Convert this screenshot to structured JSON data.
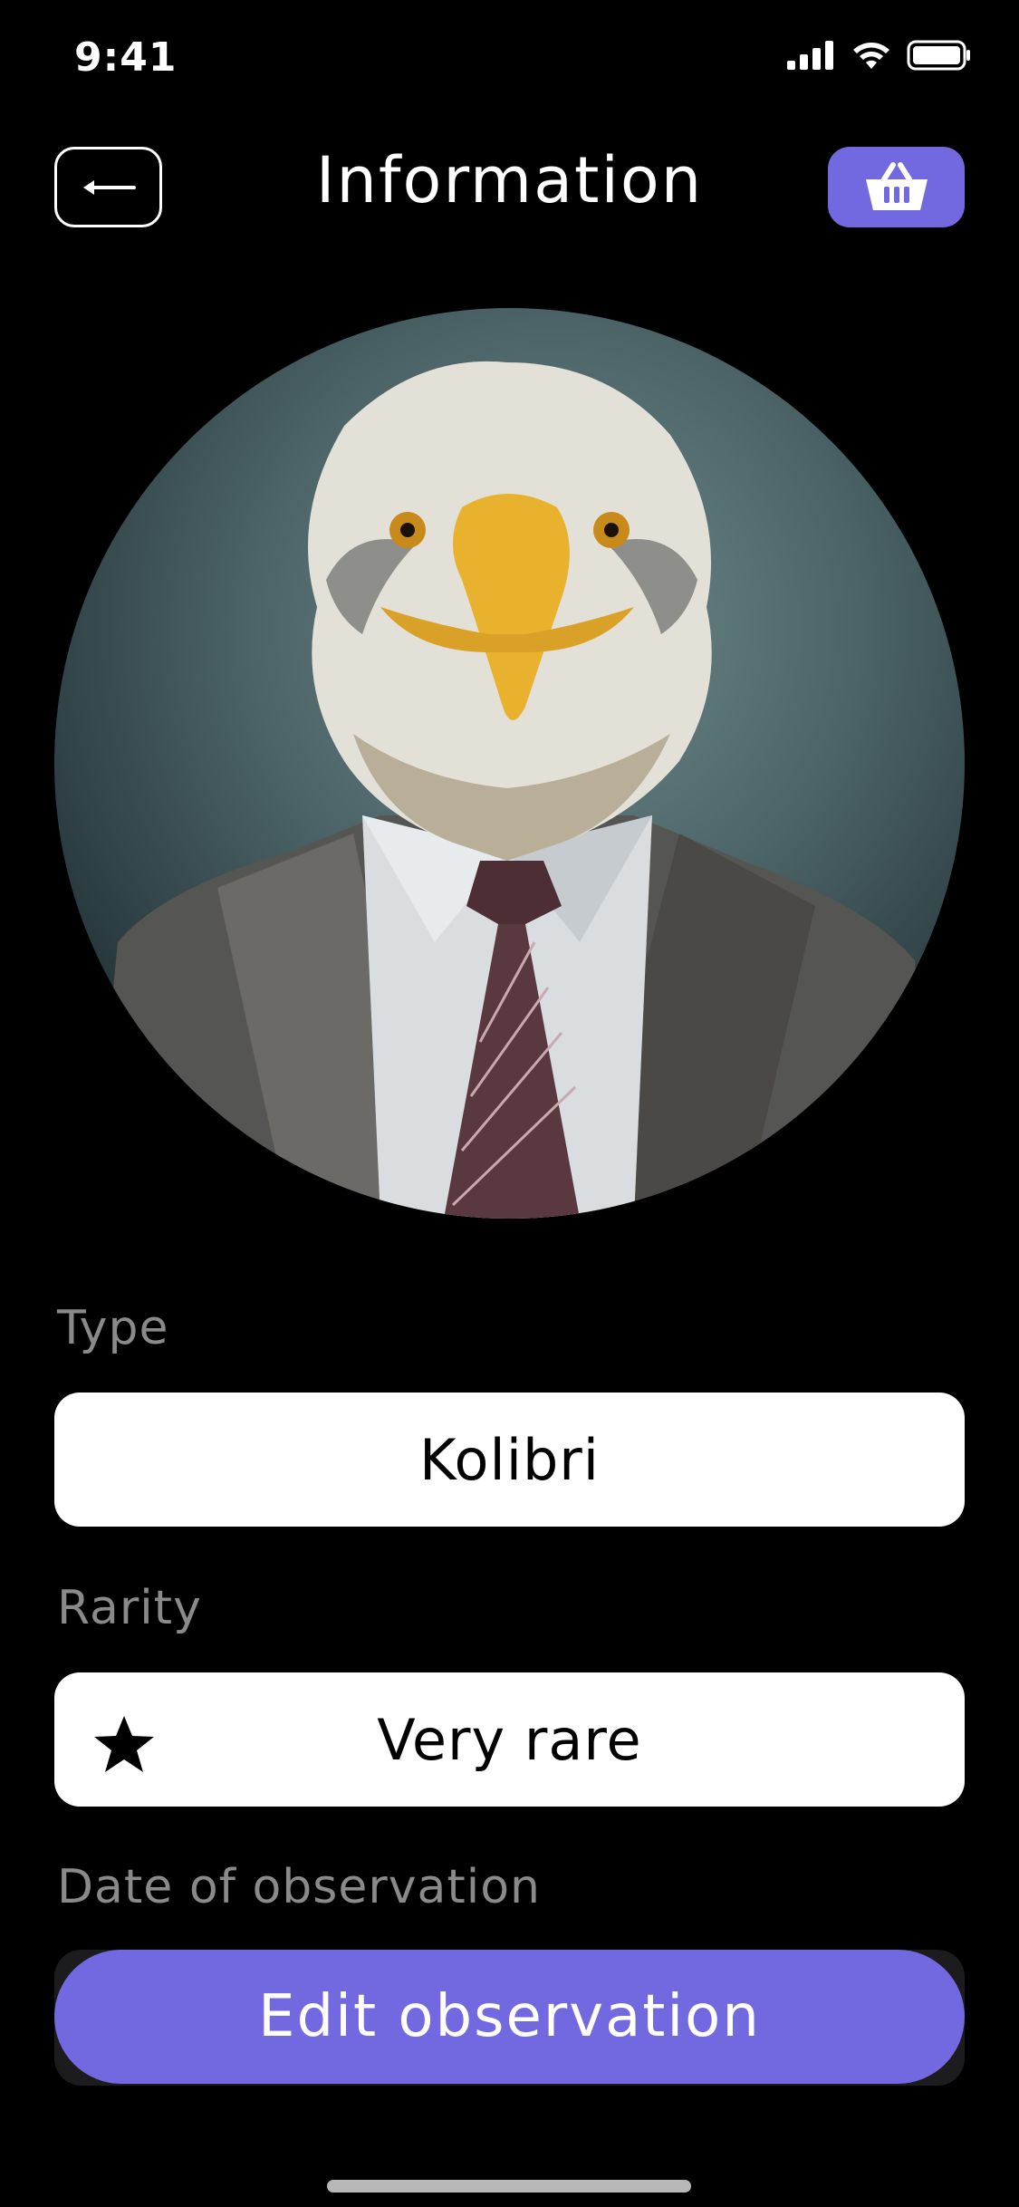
{
  "status_bar": {
    "time": "9:41"
  },
  "header": {
    "title": "Information",
    "back_icon": "arrow-left-icon",
    "cart_icon": "basket-icon"
  },
  "portrait": {
    "subject": "eagle-in-suit-portrait"
  },
  "fields": {
    "type_label": "Type",
    "type_value": "Kolibri",
    "rarity_label": "Rarity",
    "rarity_value": "Very rare",
    "rarity_icon": "star-icon",
    "date_label": "Date of observation"
  },
  "actions": {
    "edit_label": "Edit observation"
  },
  "colors": {
    "accent": "#7269e0",
    "background": "#000000",
    "label": "#8a8a8a"
  }
}
